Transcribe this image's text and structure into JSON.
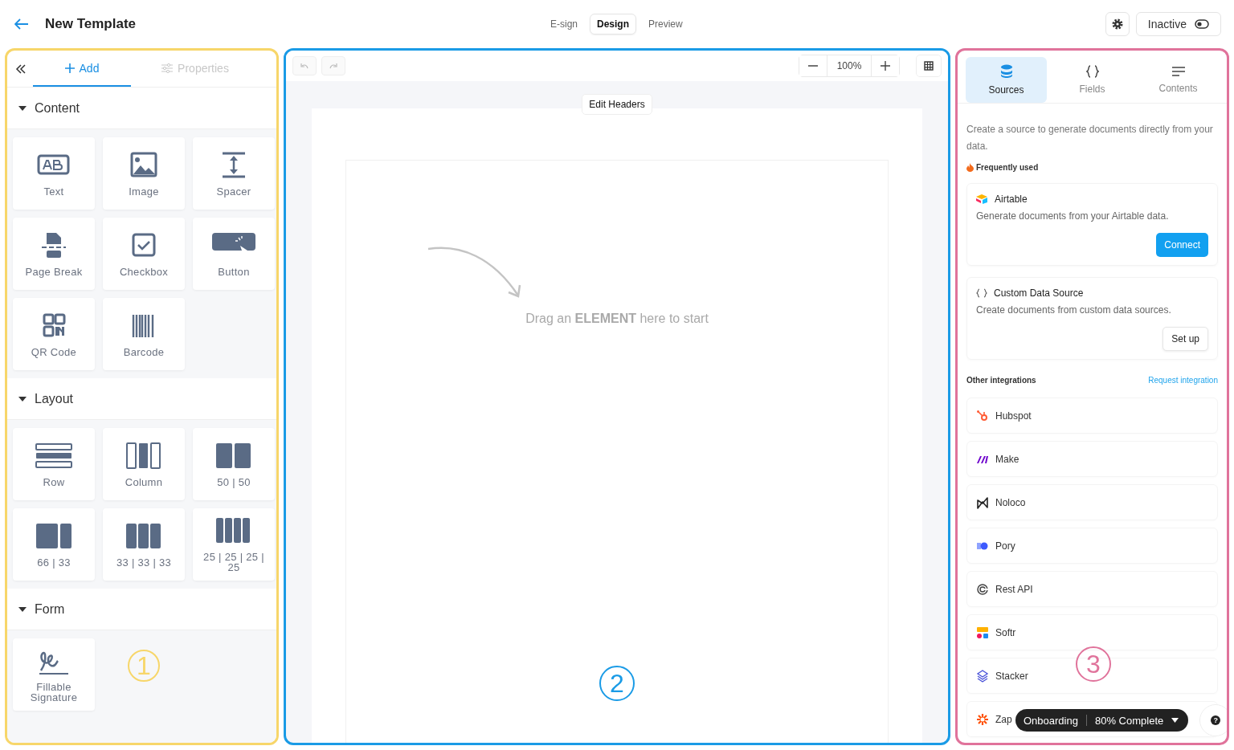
{
  "header": {
    "title": "New Template",
    "view_tabs": [
      {
        "label": "E-sign",
        "selected": false
      },
      {
        "label": "Design",
        "selected": true
      },
      {
        "label": "Preview",
        "selected": false
      }
    ],
    "status": {
      "label": "Inactive",
      "on": false
    }
  },
  "left_panel": {
    "color": "#f7d66a",
    "marker": "1",
    "tabs": [
      {
        "label": "Add",
        "kind": "add",
        "selected": true
      },
      {
        "label": "Properties",
        "kind": "properties",
        "selected": false
      }
    ],
    "sections": [
      {
        "title": "Content",
        "expanded": true,
        "items": [
          {
            "label": "Text",
            "kind": "text"
          },
          {
            "label": "Image",
            "kind": "image"
          },
          {
            "label": "Spacer",
            "kind": "spacer"
          },
          {
            "label": "Page Break",
            "kind": "pagebreak"
          },
          {
            "label": "Checkbox",
            "kind": "checkbox"
          },
          {
            "label": "Button",
            "kind": "button"
          },
          {
            "label": "QR Code",
            "kind": "qr"
          },
          {
            "label": "Barcode",
            "kind": "barcode"
          }
        ]
      },
      {
        "title": "Layout",
        "expanded": true,
        "items": [
          {
            "label": "Row",
            "kind": "row"
          },
          {
            "label": "Column",
            "kind": "column"
          },
          {
            "label": "50 | 50",
            "kind": "c2"
          },
          {
            "label": "66 | 33",
            "kind": "c66"
          },
          {
            "label": "33 | 33 | 33",
            "kind": "c3"
          },
          {
            "label": "25 | 25 | 25 | 25",
            "kind": "c4"
          }
        ]
      },
      {
        "title": "Form",
        "expanded": true,
        "items": [
          {
            "label": "Fillable Signature",
            "kind": "signature"
          }
        ]
      }
    ]
  },
  "canvas": {
    "color": "#1a9be6",
    "marker": "2",
    "zoom": "100%",
    "edit_headers": "Edit Headers",
    "placeholder": "Drag an **ELEMENT** here to start"
  },
  "right_panel": {
    "color": "#e0739b",
    "marker": "3",
    "tabs": [
      {
        "label": "Sources",
        "kind": "sources",
        "selected": true
      },
      {
        "label": "Fields",
        "kind": "fields",
        "selected": false
      },
      {
        "label": "Contents",
        "kind": "contents",
        "selected": false
      }
    ],
    "intro": "Create a source to generate documents directly from your data.",
    "frequently_used": "Frequently used",
    "featured": [
      {
        "kind": "airtable",
        "name": "Airtable",
        "description": "Generate documents from your Airtable data.",
        "action": {
          "label": "Connect",
          "kind": "primary"
        }
      },
      {
        "kind": "custom",
        "name": "Custom Data Source",
        "description": "Create documents from custom data sources.",
        "action": {
          "label": "Set up",
          "kind": "secondary"
        }
      }
    ],
    "other_label": "Other integrations",
    "request_link": "Request integration",
    "integrations": [
      {
        "name": "Hubspot",
        "kind": "hubspot"
      },
      {
        "name": "Make",
        "kind": "make"
      },
      {
        "name": "Noloco",
        "kind": "noloco"
      },
      {
        "name": "Pory",
        "kind": "pory"
      },
      {
        "name": "Rest API",
        "kind": "rest"
      },
      {
        "name": "Softr",
        "kind": "softr"
      },
      {
        "name": "Stacker",
        "kind": "stacker"
      },
      {
        "name": "Zap",
        "kind": "zapier"
      }
    ]
  },
  "onboarding": {
    "label": "Onboarding",
    "progress": "80% Complete",
    "help": "?"
  }
}
